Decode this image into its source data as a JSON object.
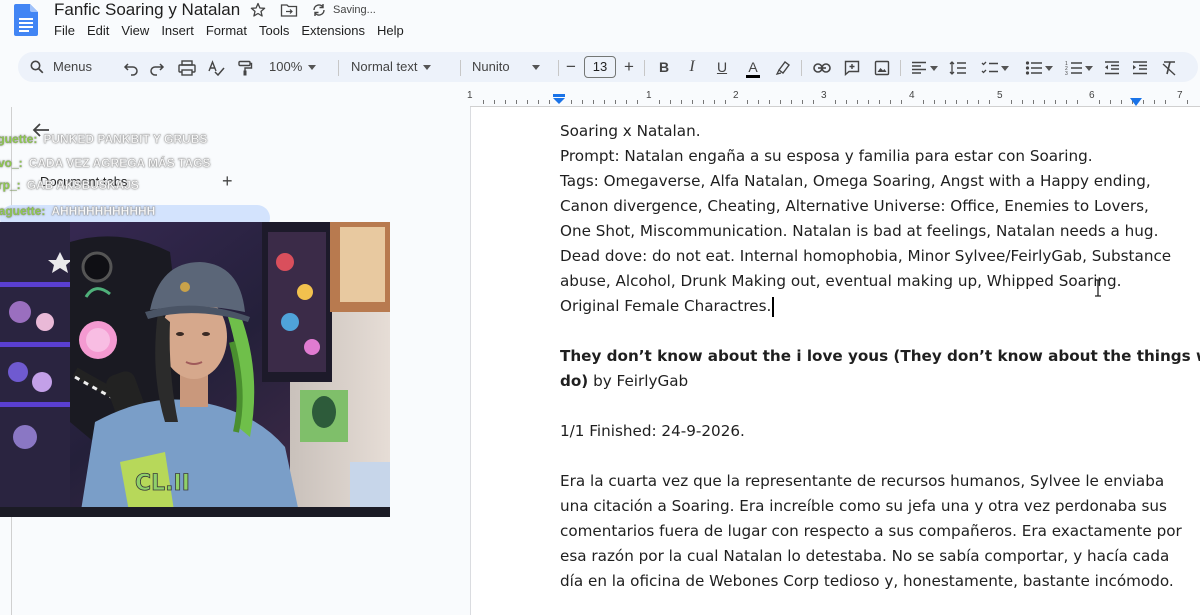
{
  "titlebar": {
    "title": "Fanfic Soaring y Natalan",
    "star_icon": "star-icon",
    "move_icon": "folder-move-icon",
    "sync_icon": "sync-icon",
    "saving": "Saving..."
  },
  "menus": [
    "File",
    "Edit",
    "View",
    "Insert",
    "Format",
    "Tools",
    "Extensions",
    "Help"
  ],
  "toolbar": {
    "search_label": "Menus",
    "zoom": "100%",
    "style": "Normal text",
    "font": "Nunito",
    "font_size": "13",
    "minus": "−",
    "plus": "+",
    "bold": "B",
    "italic": "I",
    "underline": "U",
    "text_color": "A",
    "text_color_value": "#000000"
  },
  "ruler": {
    "numbers": [
      "1",
      "1",
      "2",
      "3",
      "4",
      "5",
      "6",
      "7"
    ]
  },
  "tabs_panel": {
    "title": "Document tabs",
    "add": "+"
  },
  "chat": [
    {
      "user": "Baguette:",
      "text": "PUNKED PANKBIT Y GRUBS"
    },
    {
      "user": "vo_:",
      "text": "CADA VEZ AGREGA MÁS TAGS"
    },
    {
      "user": "rp_:",
      "text": "GAB AKSBUSKAJS"
    },
    {
      "user": "Baguette:",
      "text": "AHHHHHHHHHHH"
    }
  ],
  "webcam": {
    "shirt_text": "CL.II",
    "description_icon": "webcam-streamer-image"
  },
  "document": {
    "header_lines": [
      "Soaring x Natalan.",
      "Prompt: Natalan engaña a su esposa y familia para estar con Soaring.",
      "Tags: Omegaverse, Alfa Natalan, Omega Soaring, Angst with a Happy ending,",
      "Canon divergence, Cheating, Alternative Universe: Office, Enemies to Lovers,",
      "One Shot, Miscommunication. Natalan is bad at feelings, Natalan needs a hug.",
      "Dead dove: do not eat. Internal homophobia, Minor Sylvee/FeirlyGab, Substance",
      "abuse, Alcohol, Drunk Making out, eventual making up, Whipped Soaring.",
      "Original Female Charactres."
    ],
    "title_bold_line1": "They don’t know about the i love yous (They don’t know about the things we",
    "title_bold_line2": "do)",
    "title_author": " by FeirlyGab",
    "finished": "1/1 Finished: 24-9-2026.",
    "body_lines": [
      "Era la cuarta vez que la representante de recursos humanos, Sylvee le enviaba",
      "una citación a Soaring. Era increíble como su jefa una y otra vez perdonaba sus",
      "comentarios fuera de lugar con respecto a sus compañeros. Era exactamente por",
      "esa razón por la cual Natalan lo detestaba. No se sabía comportar, y hacía cada",
      "día en la oficina de Webones Corp tedioso y, honestamente, bastante incómodo."
    ]
  }
}
